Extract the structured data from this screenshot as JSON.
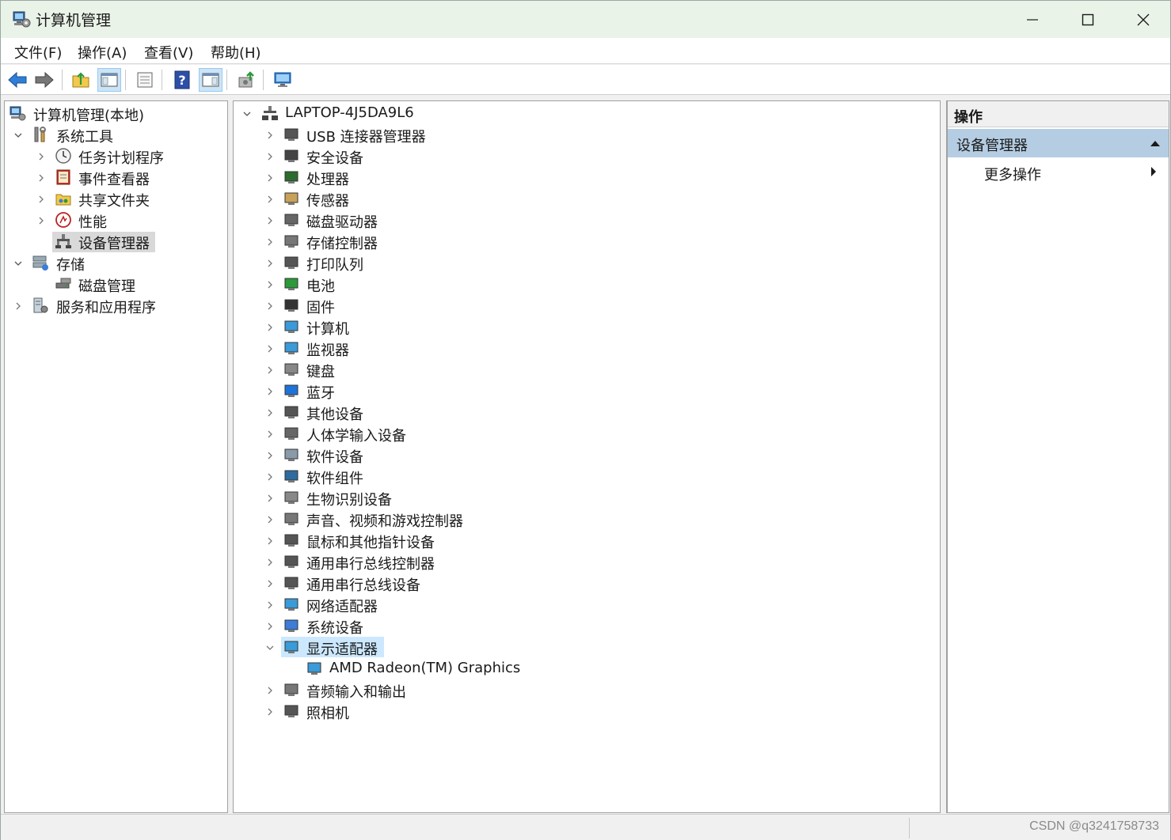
{
  "window": {
    "title": "计算机管理"
  },
  "menu": [
    "文件(F)",
    "操作(A)",
    "查看(V)",
    "帮助(H)"
  ],
  "toolbar": {
    "buttons": [
      "back-icon",
      "forward-icon",
      "up-folder-icon",
      "show-hide-console-tree-icon",
      "properties-icon",
      "help-icon",
      "show-action-pane-icon",
      "export-icon",
      "scan-hardware-icon"
    ]
  },
  "left_tree": {
    "root": "计算机管理(本地)",
    "system_tools": "系统工具",
    "task_scheduler": "任务计划程序",
    "event_viewer": "事件查看器",
    "shared_folders": "共享文件夹",
    "performance": "性能",
    "device_manager": "设备管理器",
    "storage": "存储",
    "disk_management": "磁盘管理",
    "services_apps": "服务和应用程序"
  },
  "device_tree": {
    "computer": "LAPTOP-4J5DA9L6",
    "categories": [
      "USB 连接器管理器",
      "安全设备",
      "处理器",
      "传感器",
      "磁盘驱动器",
      "存储控制器",
      "打印队列",
      "电池",
      "固件",
      "计算机",
      "监视器",
      "键盘",
      "蓝牙",
      "其他设备",
      "人体学输入设备",
      "软件设备",
      "软件组件",
      "生物识别设备",
      "声音、视频和游戏控制器",
      "鼠标和其他指针设备",
      "通用串行总线控制器",
      "通用串行总线设备",
      "网络适配器",
      "系统设备",
      "显示适配器"
    ],
    "display_child": "AMD Radeon(TM) Graphics",
    "after": [
      "音频输入和输出",
      "照相机"
    ]
  },
  "actions": {
    "header": "操作",
    "section": "设备管理器",
    "more": "更多操作"
  },
  "status": {
    "watermark": "CSDN @q3241758733"
  },
  "colors": {
    "titlebar": "#eaf3e8",
    "selection": "#cce8ff",
    "actions_section": "#b5cde3"
  }
}
